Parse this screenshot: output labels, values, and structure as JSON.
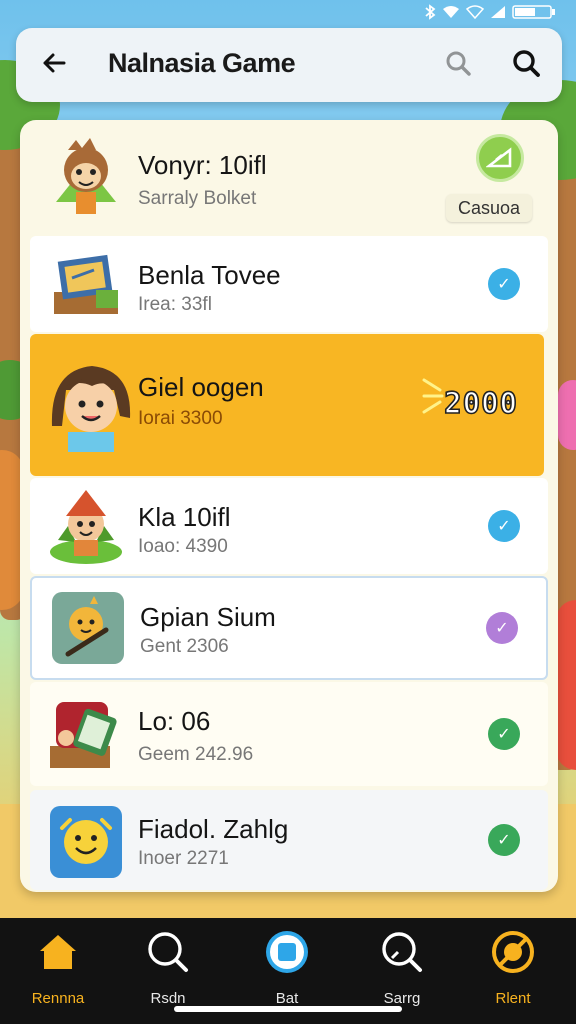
{
  "status_bar": {
    "icons": [
      "bluetooth-icon",
      "wifi-icon",
      "wifi-calling-icon",
      "signal-icon",
      "battery-icon"
    ]
  },
  "app_bar": {
    "title": "Nalnasia Game",
    "back_icon": "arrow-left-icon",
    "search_icons": [
      "search-icon",
      "search-icon"
    ]
  },
  "list": {
    "items": [
      {
        "title": "Vonyr: 10ifl",
        "subtitle": "Sarraly Bolket",
        "badge": "Casuoa",
        "avatar": "monkey-avatar",
        "style": "header"
      },
      {
        "title": "Benla Tovee",
        "subtitle": "Irea: 33fl",
        "avatar": "treasure-map-avatar",
        "check_color": "#3bb0e6",
        "style": "normal"
      },
      {
        "title": "Giel oogen",
        "subtitle": "Iorai 3300",
        "score": "2000",
        "avatar": "girl-avatar",
        "style": "highlight"
      },
      {
        "title": "Kla 10ifl",
        "subtitle": "Ioao: 4390",
        "avatar": "elf-avatar",
        "check_color": "#3bb0e6",
        "style": "normal"
      },
      {
        "title": "Gpian Sium",
        "subtitle": "Gent 2306",
        "avatar": "bird-avatar",
        "check_color": "#b17ed8",
        "style": "outlined"
      },
      {
        "title": "Lo: 06",
        "subtitle": "Geem 242.96",
        "avatar": "cards-avatar",
        "check_color": "#39a85a",
        "style": "plain"
      },
      {
        "title": "Fiadol. Zahlg",
        "subtitle": "Inoer 2271",
        "avatar": "smiley-avatar",
        "check_color": "#39a85a",
        "style": "normal"
      }
    ]
  },
  "bottom_nav": {
    "items": [
      {
        "label": "Rennna",
        "icon": "home-icon",
        "active": true
      },
      {
        "label": "Rsdn",
        "icon": "search-icon",
        "active": false
      },
      {
        "label": "Bat",
        "icon": "record-icon",
        "active": false
      },
      {
        "label": "Sarrg",
        "icon": "search-edit-icon",
        "active": false
      },
      {
        "label": "Rlent",
        "icon": "target-icon",
        "active": true
      }
    ]
  },
  "colors": {
    "accent": "#f8b623",
    "nav_background": "#121212",
    "panel_background": "#fbf8e6"
  }
}
